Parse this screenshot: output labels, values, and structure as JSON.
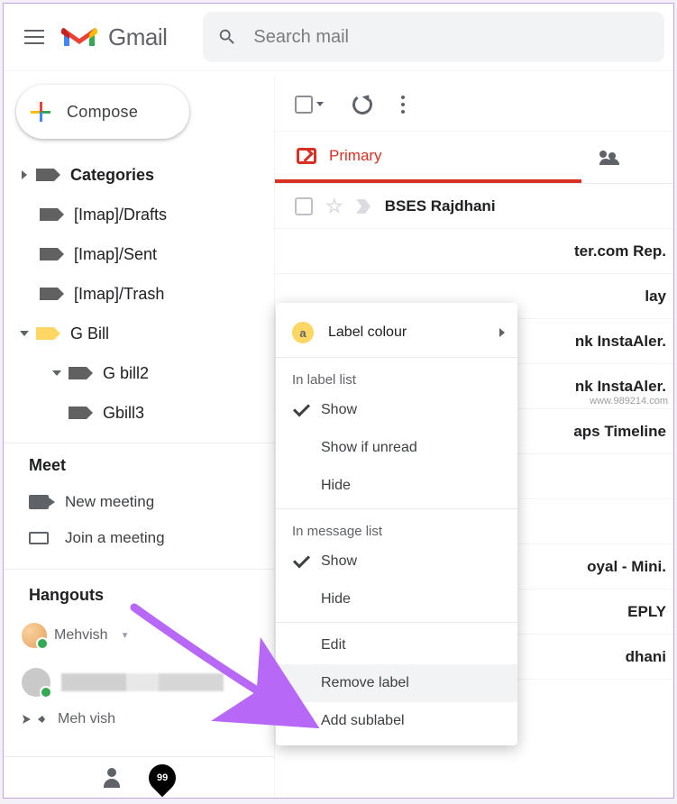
{
  "header": {
    "brand": "Gmail",
    "search_placeholder": "Search mail"
  },
  "compose_label": "Compose",
  "sidebar": {
    "items": [
      {
        "label": "Categories",
        "bold": true,
        "icon": "label",
        "caret": "closed",
        "indent": 0
      },
      {
        "label": "[Imap]/Drafts",
        "icon": "label",
        "indent": 1
      },
      {
        "label": "[Imap]/Sent",
        "icon": "label",
        "indent": 1
      },
      {
        "label": "[Imap]/Trash",
        "icon": "label",
        "indent": 1
      },
      {
        "label": "G Bill",
        "icon": "label-yellow",
        "caret": "open",
        "indent": 0
      },
      {
        "label": "G bill2",
        "icon": "label",
        "caret": "open",
        "indent": 2
      },
      {
        "label": "Gbill3",
        "icon": "label",
        "indent": 3
      }
    ]
  },
  "meet": {
    "title": "Meet",
    "new_meeting": "New meeting",
    "join_meeting": "Join a meeting"
  },
  "hangouts": {
    "title": "Hangouts",
    "username": "Mehvish",
    "contact2": "Meh vish"
  },
  "toolbar": {},
  "tabs": {
    "primary": "Primary"
  },
  "messages": [
    {
      "sender": "BSES Rajdhani"
    },
    {
      "tail": "ter.com Rep."
    },
    {
      "tail": "lay"
    },
    {
      "tail": "nk InstaAler."
    },
    {
      "tail": "nk InstaAler."
    },
    {
      "tail": "aps Timeline"
    },
    {
      "tail": ""
    },
    {
      "tail": ""
    },
    {
      "tail": "oyal - Mini."
    },
    {
      "tail": "EPLY"
    },
    {
      "tail": "dhani"
    }
  ],
  "context_menu": {
    "color_label": "Label colour",
    "group1": "In label list",
    "g1_show": "Show",
    "g1_unread": "Show if unread",
    "g1_hide": "Hide",
    "group2": "In message list",
    "g2_show": "Show",
    "g2_hide": "Hide",
    "edit": "Edit",
    "remove": "Remove label",
    "add_sub": "Add sublabel"
  },
  "watermark": "www.989214.com"
}
